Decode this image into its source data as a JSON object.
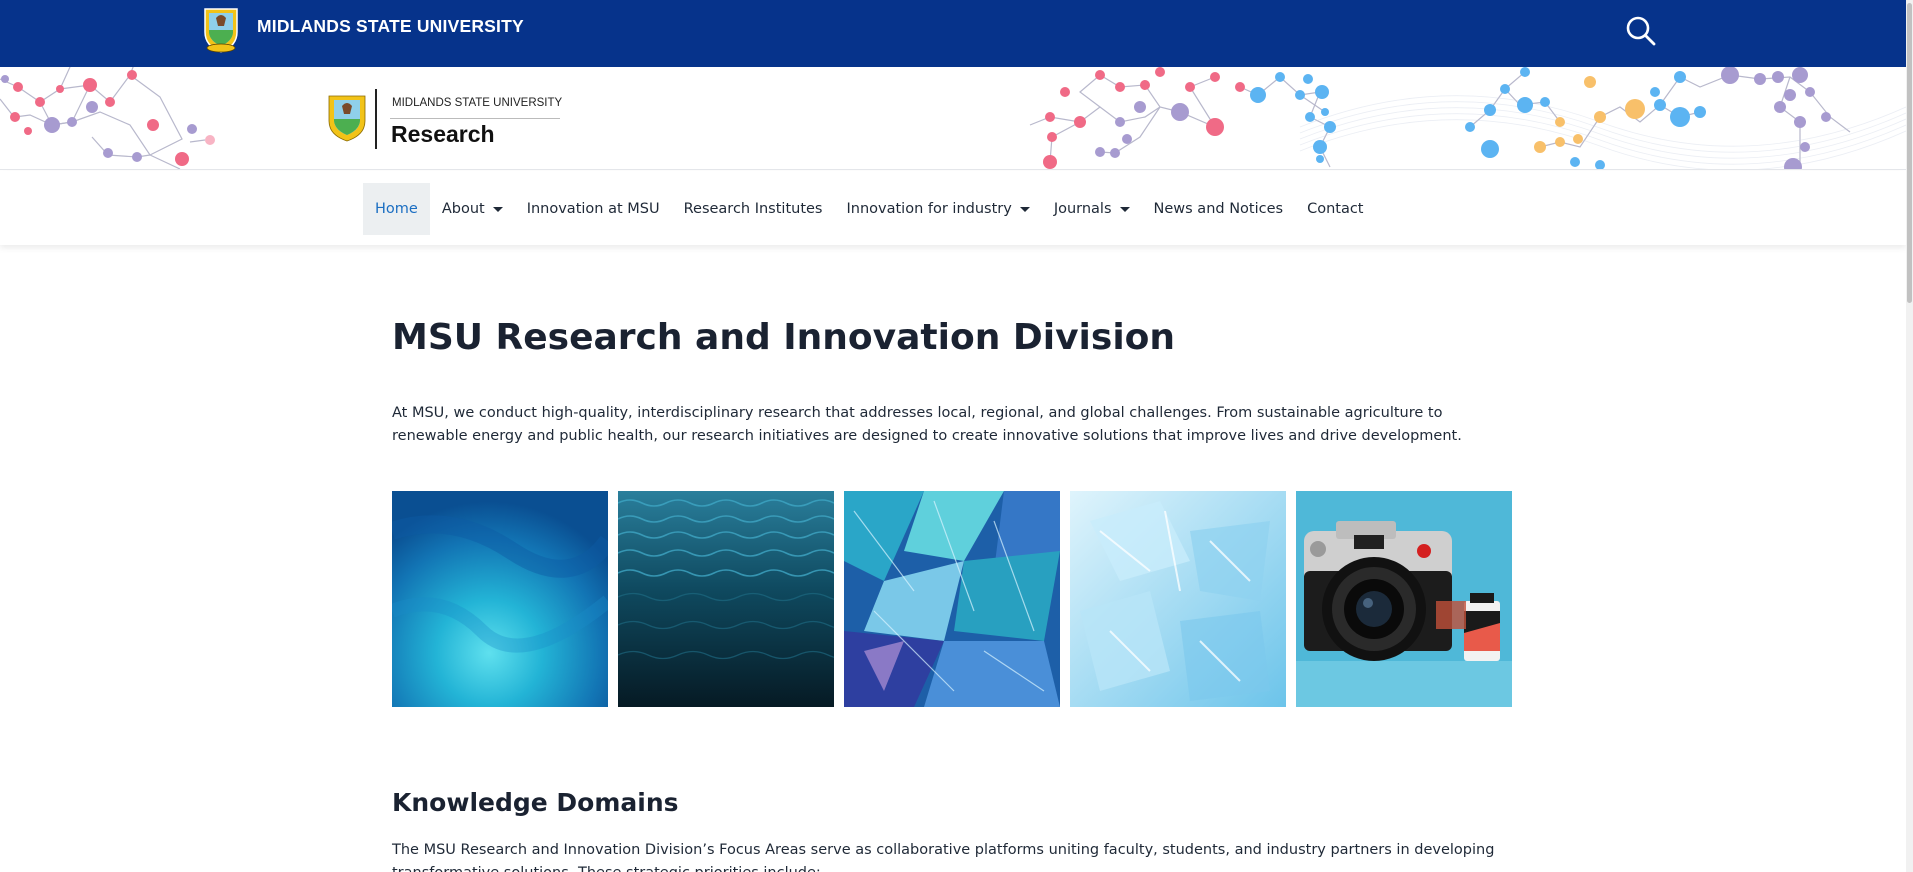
{
  "topbar": {
    "university_name": "MIDLANDS STATE UNIVERSITY",
    "background_color": "#06338b",
    "search_icon": "search-icon"
  },
  "banner": {
    "logo_small_text": "MIDLANDS STATE UNIVERSITY",
    "logo_big_text": "Research"
  },
  "nav": {
    "items": [
      {
        "label": "Home",
        "active": true,
        "dropdown": false
      },
      {
        "label": "About",
        "active": false,
        "dropdown": true
      },
      {
        "label": "Innovation at MSU",
        "active": false,
        "dropdown": false
      },
      {
        "label": "Research Institutes",
        "active": false,
        "dropdown": false
      },
      {
        "label": "Innovation for industry",
        "active": false,
        "dropdown": true
      },
      {
        "label": "Journals",
        "active": false,
        "dropdown": true
      },
      {
        "label": "News and Notices",
        "active": false,
        "dropdown": false
      },
      {
        "label": "Contact",
        "active": false,
        "dropdown": false
      }
    ],
    "active_color": "#1b6ec2"
  },
  "main": {
    "title": "MSU Research and Innovation Division",
    "intro": "At MSU, we conduct high-quality, interdisciplinary research that addresses local, regional, and global challenges. From sustainable agriculture to renewable energy and public health, our research initiatives are designed to create innovative solutions that improve lives and drive development.",
    "gallery": [
      {
        "name": "blue-water-image"
      },
      {
        "name": "dark-ocean-waves-image"
      },
      {
        "name": "blue-glass-shards-image"
      },
      {
        "name": "ice-crystals-image"
      },
      {
        "name": "leica-camera-image"
      }
    ],
    "section_title": "Knowledge Domains",
    "section_body": "The MSU Research and Innovation Division’s Focus Areas serve as collaborative platforms uniting faculty, students, and industry partners in developing transformative solutions. These strategic priorities include:"
  }
}
